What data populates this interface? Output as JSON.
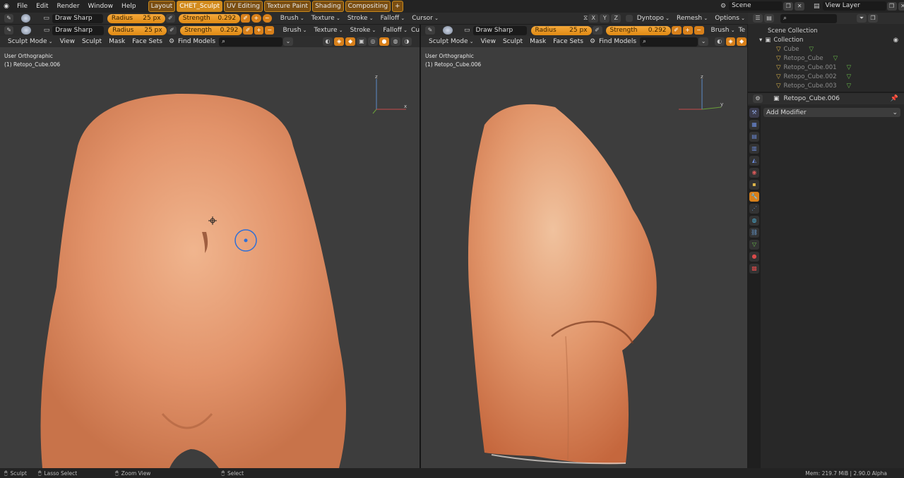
{
  "menu": [
    "File",
    "Edit",
    "Render",
    "Window",
    "Help"
  ],
  "workspaces": [
    "Layout",
    "CHET_Sculpt",
    "UV Editing",
    "Texture Paint",
    "Shading",
    "Compositing"
  ],
  "active_workspace": "CHET_Sculpt",
  "scene": "Scene",
  "view_layer": "View Layer",
  "tool": {
    "brush_name": "Draw Sharp",
    "radius_label": "Radius",
    "radius_value": "25 px",
    "strength_label": "Strength",
    "strength_value": "0.292",
    "brush": "Brush",
    "texture": "Texture",
    "stroke": "Stroke",
    "falloff": "Falloff",
    "cursor": "Cursor",
    "dyntopo": "Dyntopo",
    "remesh": "Remesh",
    "options": "Options",
    "falloff_short": "Cu",
    "texture_short": "Te",
    "x": "X",
    "y": "Y",
    "z": "Z"
  },
  "viewport_menu": {
    "mode": "Sculpt Mode",
    "view": "View",
    "sculpt": "Sculpt",
    "mask": "Mask",
    "face_sets": "Face Sets",
    "find_models": "Find Models"
  },
  "left_viewport": {
    "projection": "User Orthographic",
    "object": "(1) Retopo_Cube.006"
  },
  "right_viewport": {
    "projection": "User Orthographic",
    "object": "(1) Retopo_Cube.006"
  },
  "outliner": {
    "scene_collection": "Scene Collection",
    "collection": "Collection",
    "items": [
      "Cube",
      "Retopo_Cube",
      "Retopo_Cube.001",
      "Retopo_Cube.002",
      "Retopo_Cube.003"
    ]
  },
  "properties": {
    "object": "Retopo_Cube.006",
    "add_modifier": "Add Modifier"
  },
  "status": {
    "sculpt": "Sculpt",
    "lasso": "Lasso Select",
    "zoom": "Zoom View",
    "select": "Select",
    "memory": "Mem: 219.7 MiB | 2.90.0 Alpha"
  },
  "colors": {
    "accent": "#e08a14",
    "viewport_bg": "#3d3d3d",
    "skin": "#e0976a"
  }
}
